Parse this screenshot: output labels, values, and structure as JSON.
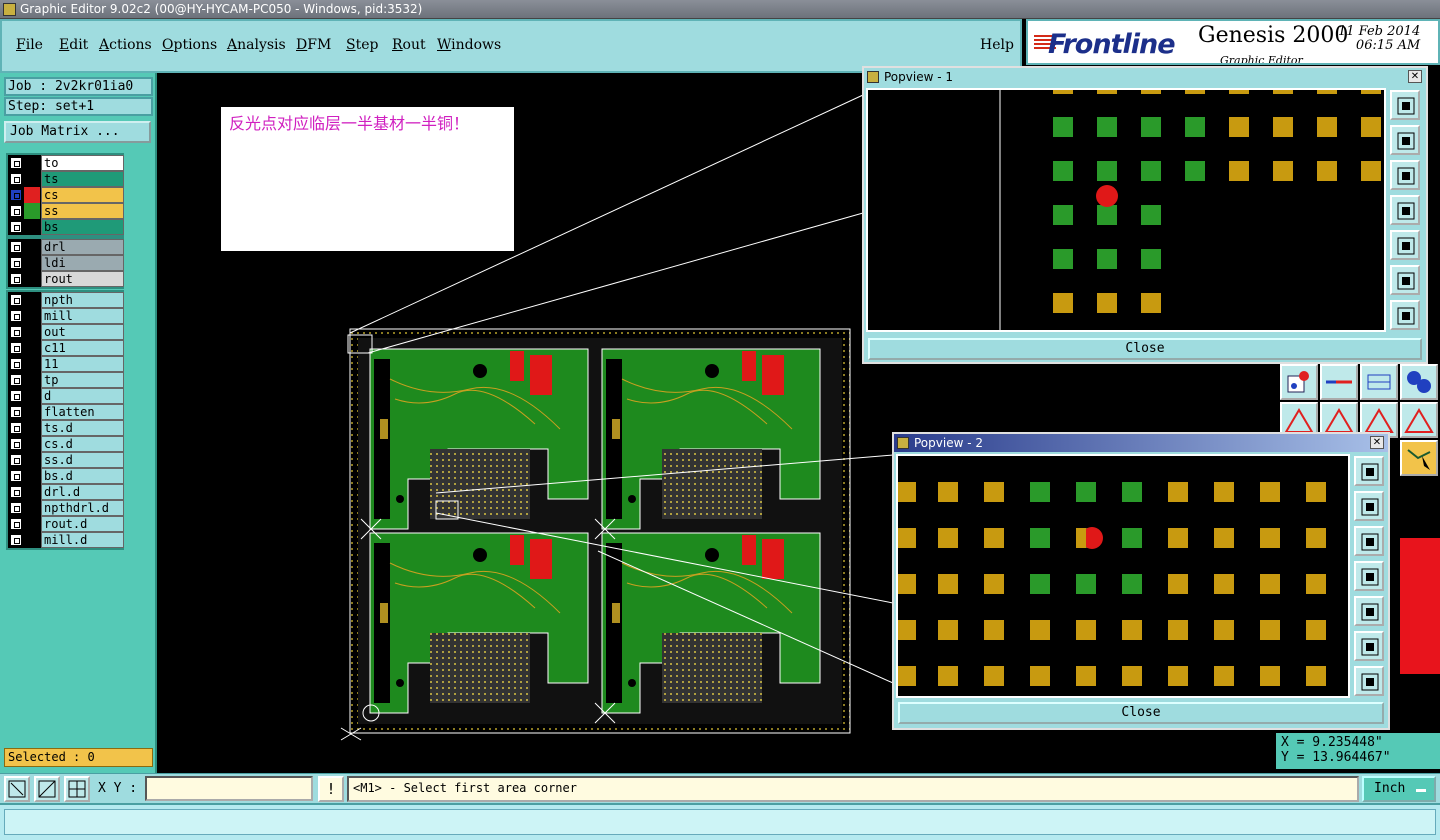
{
  "window": {
    "title": "Graphic Editor 9.02c2 (00@HY-HYCAM-PC050 - Windows, pid:3532)"
  },
  "menu": {
    "items": [
      "File",
      "Edit",
      "Actions",
      "Options",
      "Analysis",
      "DFM",
      "Step",
      "Rout",
      "Windows"
    ],
    "help": "Help"
  },
  "logo": {
    "brand": "Frontline",
    "product": "Genesis 2000",
    "subtitle": "Graphic Editor",
    "date": "11 Feb 2014",
    "time": "06:15 AM"
  },
  "job": {
    "job_label": "Job : 2v2kr01ia0",
    "step_label": "Step: set+1",
    "matrix_button": "Job Matrix ..."
  },
  "layers": {
    "board": [
      {
        "name": "to",
        "color": "#ffffff",
        "swatch": "#000000"
      },
      {
        "name": "ts",
        "color": "#1f9a78",
        "swatch": "#000000"
      },
      {
        "name": "cs",
        "color": "#f2c34a",
        "swatch": "#e02020",
        "active": true
      },
      {
        "name": "ss",
        "color": "#f2c34a",
        "swatch": "#2a9a2a"
      },
      {
        "name": "bs",
        "color": "#1f9a78",
        "swatch": "#000000"
      }
    ],
    "drill": [
      {
        "name": "drl",
        "color": "#9aaab0"
      },
      {
        "name": "ldi",
        "color": "#9aaab0"
      },
      {
        "name": "rout",
        "color": "#d8d8d8"
      }
    ],
    "misc": [
      "npth",
      "mill",
      "out",
      "c11",
      "11",
      "tp",
      "d",
      "flatten",
      "ts.d",
      "cs.d",
      "ss.d",
      "bs.d",
      "drl.d",
      "npthdrl.d",
      "rout.d",
      "mill.d"
    ]
  },
  "selected": "Selected : 0",
  "note": {
    "text": "反光点对应临层一半基材一半铜！"
  },
  "popview1": {
    "title": "Popview - 1",
    "close": "Close"
  },
  "popview2": {
    "title": "Popview - 2",
    "close": "Close"
  },
  "coords": {
    "x": "X =  9.235448\"",
    "y": "Y = 13.964467\""
  },
  "status": {
    "xy_label": "X Y :",
    "xy_value": "",
    "excl": "!",
    "prompt": "<M1> - Select first area corner",
    "units": "Inch"
  },
  "colors": {
    "panel": "#9fdcdf",
    "teal": "#55c9b6",
    "pad_gold": "#c89a10",
    "pad_green": "#2a9a2a"
  }
}
